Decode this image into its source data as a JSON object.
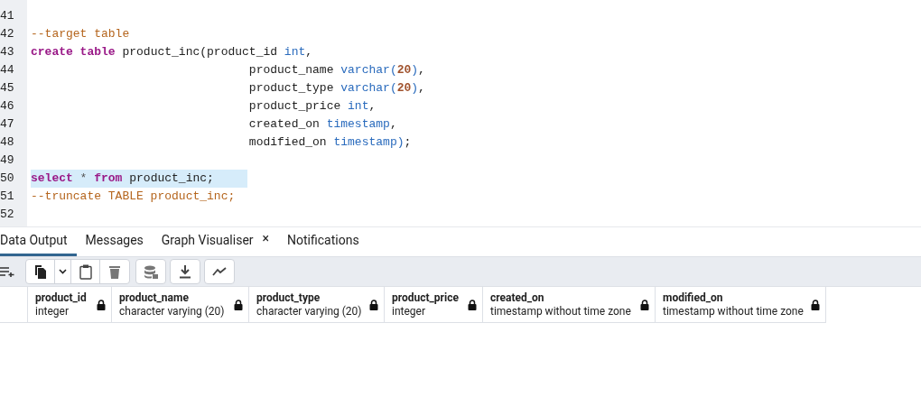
{
  "editor": {
    "lines": [
      {
        "number": "41",
        "selected": false
      },
      {
        "number": "42",
        "tokens": [
          {
            "kind": "comment",
            "text": "--target table"
          }
        ],
        "selected": false
      },
      {
        "number": "43",
        "tokens": [
          {
            "kind": "keyword",
            "text": "create "
          },
          {
            "kind": "keyword",
            "text": "table"
          },
          {
            "kind": "plain",
            "text": " product_inc(product_id "
          },
          {
            "kind": "type",
            "text": "int"
          },
          {
            "kind": "plain",
            "text": ","
          }
        ],
        "selected": false
      },
      {
        "number": "44",
        "tokens": [
          {
            "kind": "plain",
            "text": "                               product_name "
          },
          {
            "kind": "type",
            "text": "varchar"
          },
          {
            "kind": "type",
            "text": "("
          },
          {
            "kind": "number",
            "text": "20"
          },
          {
            "kind": "type",
            "text": ")"
          },
          {
            "kind": "plain",
            "text": ","
          }
        ],
        "selected": false
      },
      {
        "number": "45",
        "tokens": [
          {
            "kind": "plain",
            "text": "                               product_type "
          },
          {
            "kind": "type",
            "text": "varchar"
          },
          {
            "kind": "type",
            "text": "("
          },
          {
            "kind": "number",
            "text": "20"
          },
          {
            "kind": "type",
            "text": ")"
          },
          {
            "kind": "plain",
            "text": ","
          }
        ],
        "selected": false
      },
      {
        "number": "46",
        "tokens": [
          {
            "kind": "plain",
            "text": "                               product_price "
          },
          {
            "kind": "type",
            "text": "int"
          },
          {
            "kind": "plain",
            "text": ","
          }
        ],
        "selected": false
      },
      {
        "number": "47",
        "tokens": [
          {
            "kind": "plain",
            "text": "                               created_on "
          },
          {
            "kind": "type",
            "text": "timestamp"
          },
          {
            "kind": "plain",
            "text": ","
          }
        ],
        "selected": false
      },
      {
        "number": "48",
        "tokens": [
          {
            "kind": "plain",
            "text": "                               modified_on "
          },
          {
            "kind": "type",
            "text": "timestamp"
          },
          {
            "kind": "type",
            "text": ")"
          },
          {
            "kind": "plain",
            "text": ";"
          }
        ],
        "selected": false
      },
      {
        "number": "49",
        "selected": false
      },
      {
        "number": "50",
        "tokens": [
          {
            "kind": "keyword",
            "text": "select "
          },
          {
            "kind": "operator",
            "text": "* "
          },
          {
            "kind": "keyword",
            "text": "from"
          },
          {
            "kind": "plain",
            "text": " product_inc;"
          }
        ],
        "selected": true
      },
      {
        "number": "51",
        "tokens": [
          {
            "kind": "comment",
            "text": "--truncate TABLE product_inc;"
          }
        ],
        "selected": false
      },
      {
        "number": "52",
        "selected": false
      }
    ]
  },
  "tabs": [
    {
      "label": "Data Output",
      "selected": true
    },
    {
      "label": "Messages",
      "selected": false
    },
    {
      "label": "Graph Visualiser",
      "selected": false,
      "close": "×"
    },
    {
      "label": "Notifications",
      "selected": false
    }
  ],
  "table": {
    "columns": [
      {
        "name": "product_id",
        "type": "integer"
      },
      {
        "name": "product_name",
        "type": "character varying (20)"
      },
      {
        "name": "product_type",
        "type": "character varying (20)"
      },
      {
        "name": "product_price",
        "type": "integer"
      },
      {
        "name": "created_on",
        "type": "timestamp without time zone"
      },
      {
        "name": "modified_on",
        "type": "timestamp without time zone"
      }
    ]
  }
}
